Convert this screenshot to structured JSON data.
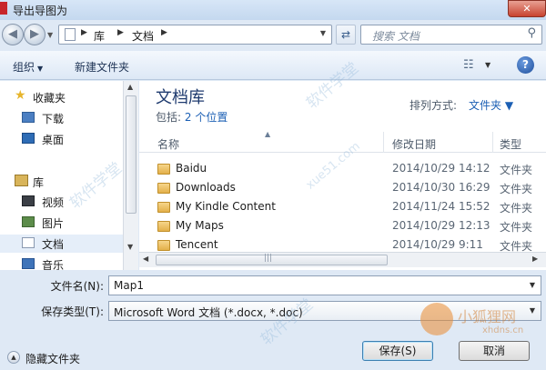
{
  "window": {
    "title": "导出导图为",
    "close_glyph": "✕"
  },
  "nav": {
    "back_glyph": "◀",
    "forward_glyph": "▶",
    "breadcrumb": [
      "库",
      "文档"
    ],
    "search_placeholder": "搜索 文档"
  },
  "toolbar": {
    "organize": "组织",
    "new_folder": "新建文件夹",
    "help": "?"
  },
  "sidebar": {
    "favorites": "收藏夹",
    "favorite_items": [
      "下载",
      "桌面"
    ],
    "libraries": "库",
    "library_items": [
      "视频",
      "图片",
      "文档",
      "音乐"
    ]
  },
  "library": {
    "title": "文档库",
    "includes_label": "包括:",
    "includes_link": "2 个位置",
    "arrange_label": "排列方式:",
    "arrange_value": "文件夹 ▼"
  },
  "columns": {
    "name": "名称",
    "modified": "修改日期",
    "type": "类型"
  },
  "files": [
    {
      "name": "Baidu",
      "date": "2014/10/29 14:12",
      "type": "文件夹"
    },
    {
      "name": "Downloads",
      "date": "2014/10/30 16:29",
      "type": "文件夹"
    },
    {
      "name": "My Kindle Content",
      "date": "2014/11/24 15:52",
      "type": "文件夹"
    },
    {
      "name": "My Maps",
      "date": "2014/10/29 12:13",
      "type": "文件夹"
    },
    {
      "name": "Tencent",
      "date": "2014/10/29 9:11",
      "type": "文件夹"
    }
  ],
  "form": {
    "filename_label": "文件名(N):",
    "filename_value": "Map1",
    "filetype_label": "保存类型(T):",
    "filetype_value": "Microsoft Word 文档 (*.docx, *.doc)"
  },
  "footer": {
    "hide_folders": "隐藏文件夹",
    "save": "保存(S)",
    "cancel": "取消"
  },
  "watermark": {
    "brand": "小狐狸网",
    "site": "xhdns.cn",
    "diagonal": "软件学堂",
    "diagonal_latin": "xue51.com"
  }
}
